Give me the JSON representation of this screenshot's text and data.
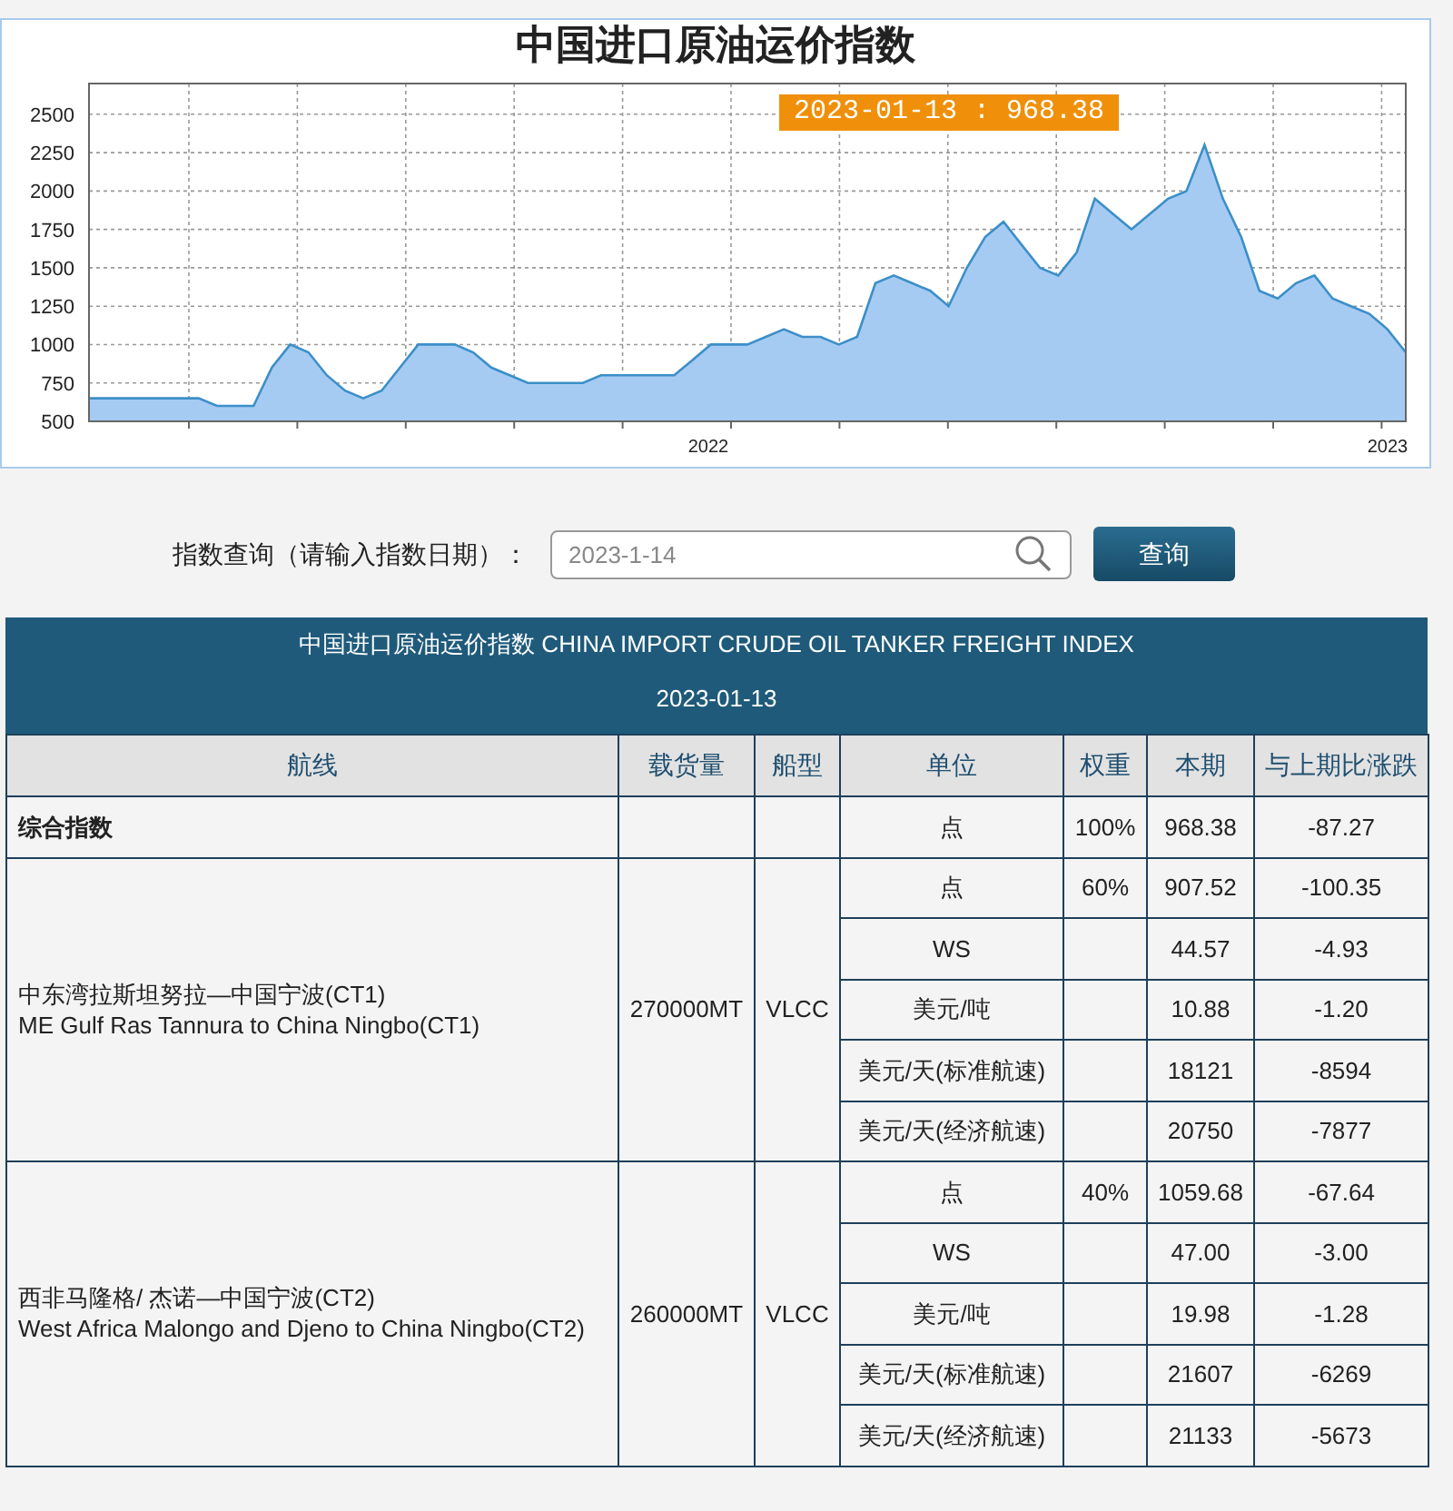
{
  "chart_panel": {
    "badge": "2023-01-13 : 968.38",
    "x_axis_labels": [
      "2022",
      "2023"
    ],
    "chart_data": {
      "type": "area",
      "title": "中国进口原油运价指数",
      "grid": true,
      "ylim": [
        500,
        2700
      ],
      "yticks": [
        500,
        750,
        1000,
        1250,
        1500,
        1750,
        2000,
        2250,
        2500
      ],
      "series": [
        {
          "color": "#a6cbf3",
          "values": [
            650,
            650,
            650,
            650,
            650,
            650,
            650,
            600,
            600,
            600,
            850,
            1000,
            950,
            800,
            700,
            650,
            700,
            850,
            1000,
            1000,
            1000,
            950,
            850,
            800,
            750,
            750,
            750,
            750,
            800,
            800,
            800,
            800,
            800,
            900,
            1000,
            1000,
            1000,
            1050,
            1100,
            1050,
            1050,
            1000,
            1050,
            1400,
            1450,
            1400,
            1350,
            1250,
            1500,
            1700,
            1800,
            1650,
            1500,
            1450,
            1600,
            1950,
            1850,
            1750,
            1850,
            1950,
            2000,
            2300,
            1950,
            1700,
            1350,
            1300,
            1400,
            1450,
            1300,
            1250,
            1200,
            1100,
            950
          ]
        }
      ]
    }
  },
  "query": {
    "label": "指数查询（请输入指数日期）：",
    "placeholder": "2023-1-14",
    "button": "查询"
  },
  "table": {
    "title": "中国进口原油运价指数 CHINA IMPORT CRUDE OIL TANKER FREIGHT INDEX",
    "date": "2023-01-13",
    "columns": [
      "航线",
      "载货量",
      "船型",
      "单位",
      "权重",
      "本期",
      "与上期比涨跌"
    ],
    "groups": [
      {
        "kind": "plain",
        "route": [
          "综合指数"
        ],
        "rows": [
          {
            "unit": "点",
            "weight": "100%",
            "current": "968.38",
            "change": "-87.27"
          }
        ]
      },
      {
        "kind": "route",
        "route": [
          "中东湾拉斯坦努拉—中国宁波(CT1)",
          "ME Gulf Ras Tannura to China Ningbo(CT1)"
        ],
        "cargo": "270000MT",
        "ship": "VLCC",
        "rows": [
          {
            "unit": "点",
            "weight": "60%",
            "current": "907.52",
            "change": "-100.35"
          },
          {
            "unit": "WS",
            "current": "44.57",
            "change": "-4.93"
          },
          {
            "unit": "美元/吨",
            "current": "10.88",
            "change": "-1.20"
          },
          {
            "unit": "美元/天(标准航速)",
            "current": "18121",
            "change": "-8594"
          },
          {
            "unit": "美元/天(经济航速)",
            "current": "20750",
            "change": "-7877"
          }
        ]
      },
      {
        "kind": "route",
        "route": [
          "西非马隆格/ 杰诺—中国宁波(CT2)",
          "West Africa Malongo and Djeno to China Ningbo(CT2)"
        ],
        "cargo": "260000MT",
        "ship": "VLCC",
        "rows": [
          {
            "unit": "点",
            "weight": "40%",
            "current": "1059.68",
            "change": "-67.64"
          },
          {
            "unit": "WS",
            "current": "47.00",
            "change": "-3.00"
          },
          {
            "unit": "美元/吨",
            "current": "19.98",
            "change": "-1.28"
          },
          {
            "unit": "美元/天(标准航速)",
            "current": "21607",
            "change": "-6269"
          },
          {
            "unit": "美元/天(经济航速)",
            "current": "21133",
            "change": "-5673"
          }
        ]
      }
    ]
  }
}
